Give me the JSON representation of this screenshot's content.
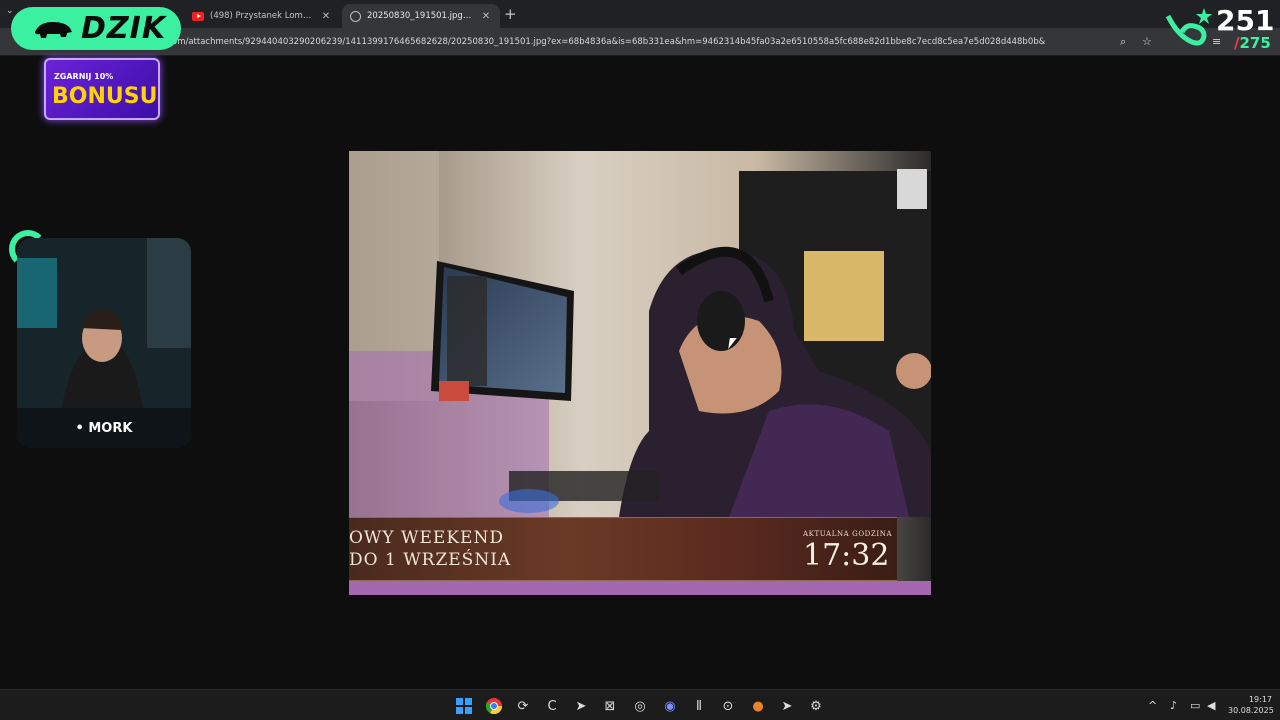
{
  "browser": {
    "tabs": [
      {
        "title": "(498) Przystanek Lombard - Od",
        "favicon": "youtube-icon",
        "active": false
      },
      {
        "title": "20250830_191501.jpg (972×74",
        "favicon": "globe-icon",
        "active": true
      }
    ],
    "url": "om/attachments/929440403290206239/1411399176465682628/20250830_191501.jpg?ex=68b4836a&is=68b331ea&hm=9462314b45fa03a2e6510558a5fc688e82d1bbe8c7ecd8c5ea7e5d028d448b0b&",
    "icons": [
      "zoom-icon",
      "star-icon",
      "extensions-icon",
      "media-icon"
    ]
  },
  "overlay": {
    "brand": "DZIK",
    "bonus_small": "ZGARNIJ 10%",
    "bonus_big": "BONUSU",
    "cam_name": "MORK",
    "counter_main": "251",
    "counter_sub_slash": "/",
    "counter_sub_value": "275",
    "accent": "#3bf0a0"
  },
  "photo": {
    "banner_line1": "OWY WEEKEND",
    "banner_line2": "DO 1 WRZEŚNIA",
    "clock_label": "AKTUALNA GODZINA",
    "clock_time": "17:32"
  },
  "taskbar": {
    "icons": [
      "windows-start-icon",
      "chrome-icon",
      "app-icon",
      "ccleaner-icon",
      "steam-icon",
      "xbox-icon",
      "app-icon",
      "discord-icon",
      "app-icon",
      "app-icon",
      "app-icon",
      "steam-icon",
      "settings-icon"
    ],
    "discord_badge": "9+",
    "time": "19:17",
    "date": "30.08.2025"
  }
}
